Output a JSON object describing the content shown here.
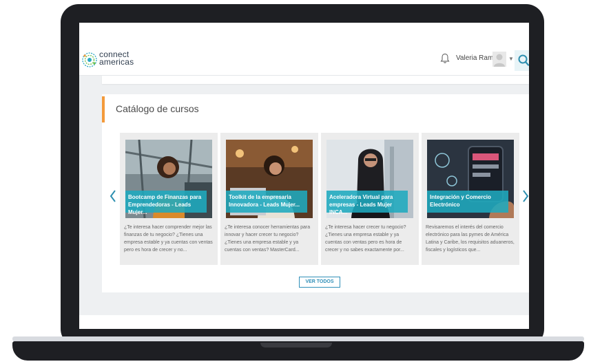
{
  "brand": {
    "line1": "connect",
    "line2": "americas"
  },
  "user": {
    "name": "Valeria Ramos"
  },
  "catalog": {
    "title": "Catálogo de cursos",
    "view_all_label": "VER TODOS",
    "courses": [
      {
        "title": "Bootcamp de Finanzas para Emprendedoras - Leads Mujer...",
        "description": "¿Te interesa hacer comprender mejor las finanzas de tu negocio? ¿Tienes una empresa estable y ya cuentas con ventas pero es hora de crecer y no..."
      },
      {
        "title": "Toolkit de la empresaria Innovadora - Leads Mujer...",
        "description": "¿Te interesa conocer herramientas para innovar y hacer crecer tu negocio? ¿Tienes una empresa estable y ya cuentas con ventas? MasterCard..."
      },
      {
        "title": "Aceleradora Virtual para empresas - Leads Mujer INCA...",
        "description": "¿Te interesa hacer crecer tu negocio? ¿Tienes una empresa estable y ya cuentas con ventas pero es hora de crecer y no sabes exactamente por..."
      },
      {
        "title": "Integración y Comercio Electrónico",
        "description": "Revisaremos el interés del comercio electrónico para las pymes de América Latina y Caribe, los requisitos aduaneros, fiscales y logísticos que..."
      }
    ]
  },
  "colors": {
    "accent": "#f39a3b",
    "brand_teal": "#1faabe",
    "link_blue": "#2f8fb8"
  }
}
